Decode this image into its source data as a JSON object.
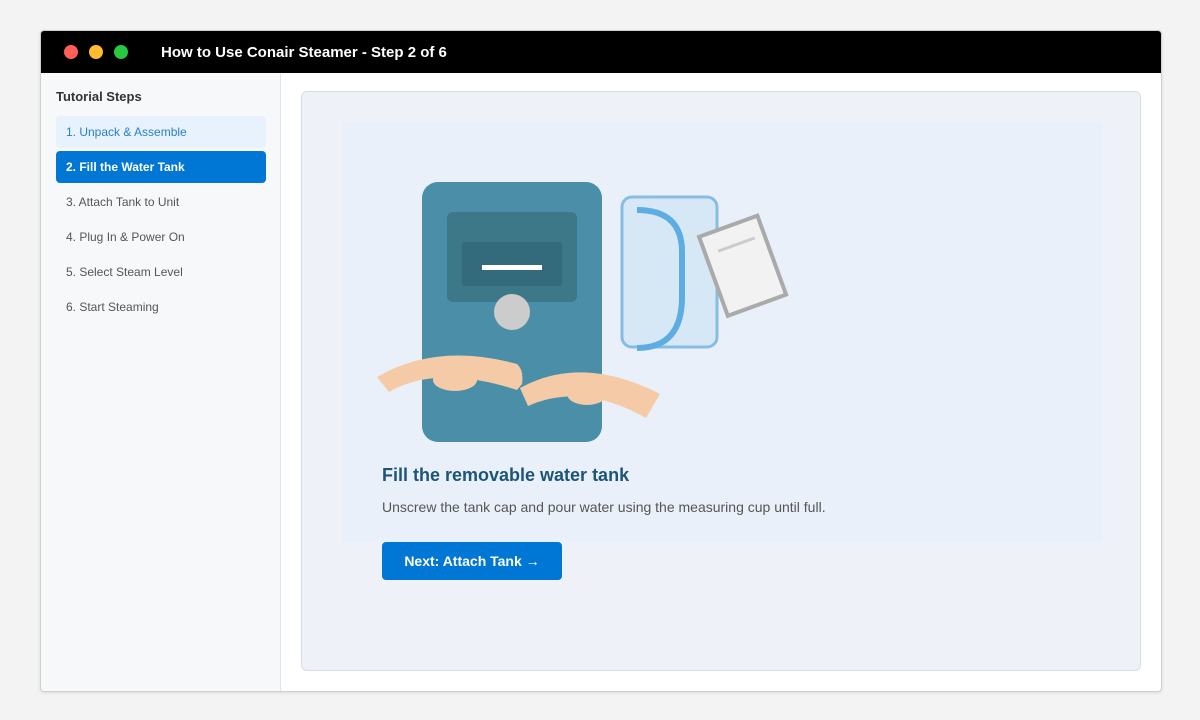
{
  "window": {
    "title": "How to Use Conair Steamer - Step 2 of 6"
  },
  "sidebar": {
    "heading": "Tutorial Steps",
    "items": [
      {
        "label": "1. Unpack & Assemble",
        "state": "visited"
      },
      {
        "label": "2. Fill the Water Tank",
        "state": "active"
      },
      {
        "label": "3. Attach Tank to Unit",
        "state": "default"
      },
      {
        "label": "4. Plug In & Power On",
        "state": "default"
      },
      {
        "label": "5. Select Steam Level",
        "state": "default"
      },
      {
        "label": "6. Start Steaming",
        "state": "default"
      }
    ]
  },
  "main": {
    "step_title": "Fill the removable water tank",
    "step_description": "Unscrew the tank cap and pour water using the measuring cup until full.",
    "next_button_label": "Next: Attach Tank →"
  },
  "colors": {
    "accent": "#0077d4",
    "steamer_body": "#4a8fa7",
    "tank": "#5dade2",
    "hand": "#f5cba7"
  }
}
